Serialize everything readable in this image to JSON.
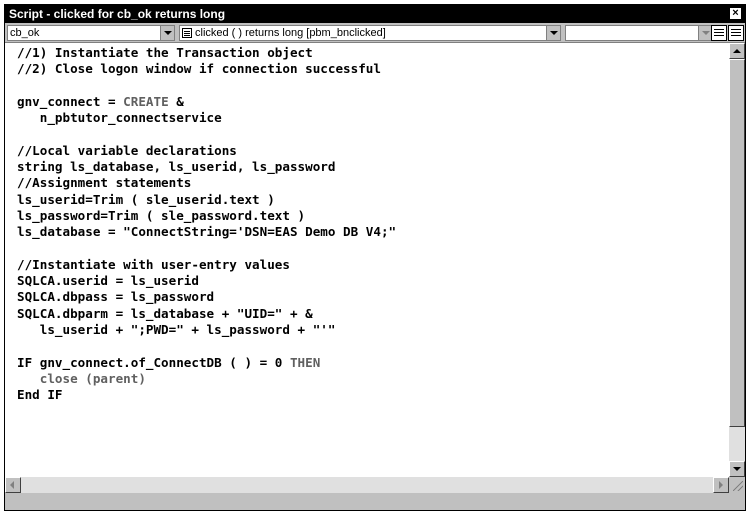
{
  "window": {
    "title": "Script - clicked for cb_ok returns long",
    "close_label": "×"
  },
  "toolbar": {
    "object_dropdown": "cb_ok",
    "event_dropdown": "clicked ( )  returns long [pbm_bnclicked]",
    "ancestor_dropdown": ""
  },
  "code_lines": [
    {
      "text": "//1) Instantiate the Transaction object"
    },
    {
      "text": "//2) Close logon window if connection successful"
    },
    {
      "text": ""
    },
    {
      "text": "gnv_connect = ",
      "kw": "CREATE",
      "rest": " &"
    },
    {
      "text": "   n_pbtutor_connectservice"
    },
    {
      "text": ""
    },
    {
      "text": "//Local variable declarations"
    },
    {
      "text": "string ls_database, ls_userid, ls_password"
    },
    {
      "text": "//Assignment statements"
    },
    {
      "text": "ls_userid=Trim ( sle_userid.text )"
    },
    {
      "text": "ls_password=Trim ( sle_password.text )"
    },
    {
      "text": "ls_database = \"ConnectString='DSN=EAS Demo DB V4;\""
    },
    {
      "text": ""
    },
    {
      "text": "//Instantiate with user-entry values"
    },
    {
      "text": "SQLCA.userid = ls_userid"
    },
    {
      "text": "SQLCA.dbpass = ls_password"
    },
    {
      "text": "SQLCA.dbparm = ls_database + \"UID=\" + &"
    },
    {
      "text": "   ls_userid + \";PWD=\" + ls_password + \"'\""
    },
    {
      "text": ""
    },
    {
      "text": "IF gnv_connect.of_ConnectDB ( ) = 0 ",
      "kw": "THEN",
      "rest": ""
    },
    {
      "text": "",
      "kw": "   close (parent)",
      "rest": ""
    },
    {
      "text": "End IF"
    }
  ],
  "colors": {
    "titlebar": "#000000",
    "keyword": "#606060",
    "editor_bg": "#ffffff",
    "chrome": "#c0c0c0"
  }
}
